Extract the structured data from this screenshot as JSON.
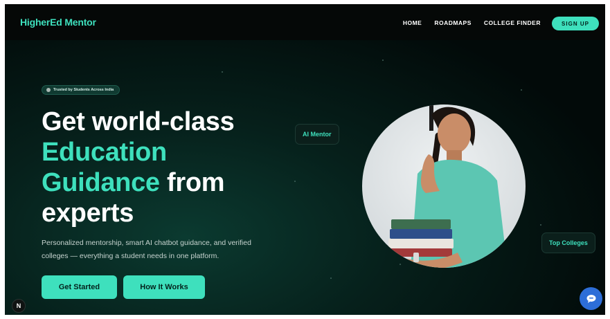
{
  "nav": {
    "logo": "HigherEd Mentor",
    "links": [
      "HOME",
      "ROADMAPS",
      "COLLEGE FINDER"
    ],
    "signup": "SIGN UP"
  },
  "hero": {
    "badge": "Trusted by Students Across India",
    "headline_1": "Get world-class",
    "headline_2": "Education",
    "headline_3": "Guidance",
    "headline_4": " from",
    "headline_5": "experts",
    "subtext": "Personalized mentorship, smart AI chatbot guidance, and verified colleges — everything a student needs in one platform.",
    "primary_cta": "Get Started",
    "secondary_cta": "How It Works"
  },
  "floating": {
    "ai_mentor": "AI Mentor",
    "top_colleges": "Top Colleges"
  },
  "corner_badge": "N",
  "colors": {
    "accent": "#3ee0bd",
    "background": "#020a09",
    "chat_button": "#2d6ed8"
  },
  "icons": [
    "chat-bubble-icon",
    "trusted-badge-icon"
  ]
}
